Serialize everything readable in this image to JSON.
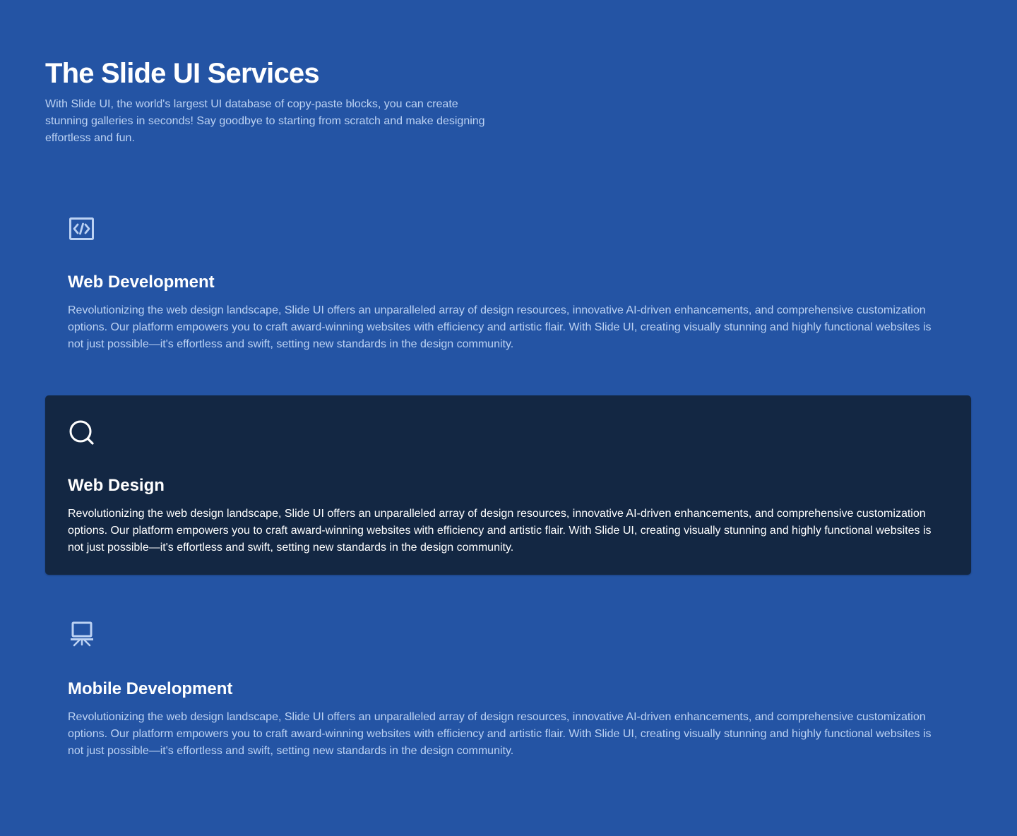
{
  "header": {
    "title": "The Slide UI Services",
    "description": "With Slide UI, the world's largest UI database of copy-paste blocks, you can create stunning galleries in seconds! Say goodbye to starting from scratch and make designing effortless and fun."
  },
  "services": [
    {
      "icon": "code-icon",
      "title": "Web Development",
      "description": "Revolutionizing the web design landscape, Slide UI offers an unparalleled array of design resources, innovative AI-driven enhancements, and comprehensive customization options. Our platform empowers you to craft award-winning websites with efficiency and artistic flair. With Slide UI, creating visually stunning and highly functional websites is not just possible—it's effortless and swift, setting new standards in the design community."
    },
    {
      "icon": "search-icon",
      "title": "Web Design",
      "description": "Revolutionizing the web design landscape, Slide UI offers an unparalleled array of design resources, innovative AI-driven enhancements, and comprehensive customization options. Our platform empowers you to craft award-winning websites with efficiency and artistic flair. With Slide UI, creating visually stunning and highly functional websites is not just possible—it's effortless and swift, setting new standards in the design community."
    },
    {
      "icon": "presentation-icon",
      "title": "Mobile Development",
      "description": "Revolutionizing the web design landscape, Slide UI offers an unparalleled array of design resources, innovative AI-driven enhancements, and comprehensive customization options. Our platform empowers you to craft award-winning websites with efficiency and artistic flair. With Slide UI, creating visually stunning and highly functional websites is not just possible—it's effortless and swift, setting new standards in the design community."
    }
  ],
  "colors": {
    "background": "#2454a4",
    "active_card": "#132743",
    "muted_text": "#bcd2f3",
    "icon_light": "#bcd2f3",
    "icon_active": "#ffffff"
  }
}
